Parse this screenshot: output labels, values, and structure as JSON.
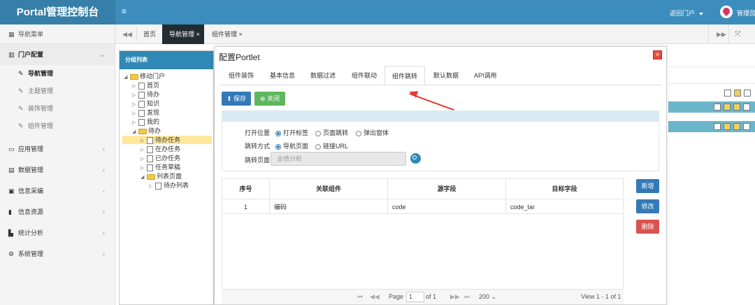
{
  "topbar": {
    "brand": "Portal管理控制台",
    "toggle_icon": "≡",
    "back_portal": "返回门户",
    "admin_label": "管理员"
  },
  "sidebar": {
    "header": "导航菜单",
    "menus": [
      {
        "label": "门户配置",
        "icon": "bank-icon",
        "open": true
      },
      {
        "label": "应用管理",
        "icon": "monitor-icon"
      },
      {
        "label": "数据管理",
        "icon": "database-icon"
      },
      {
        "label": "信息采编",
        "icon": "edit-icon"
      },
      {
        "label": "信息资源",
        "icon": "book-icon"
      },
      {
        "label": "统计分析",
        "icon": "chart-icon"
      },
      {
        "label": "系统管理",
        "icon": "gears-icon"
      }
    ],
    "submenu": [
      {
        "label": "导航管理",
        "active": true
      },
      {
        "label": "主题管理"
      },
      {
        "label": "装饰管理"
      },
      {
        "label": "组件管理"
      }
    ]
  },
  "tabbar": {
    "tabs": [
      {
        "label": "首页"
      },
      {
        "label": "导航管理",
        "active": true
      },
      {
        "label": "组件管理"
      }
    ]
  },
  "tree": {
    "header": "分组列表",
    "root": "移动门户",
    "nodes": [
      "首页",
      "待办",
      "知识",
      "发现",
      "我的",
      "待办",
      "待办任务",
      "在办任务",
      "已办任务",
      "任务草稿",
      "列表页面",
      "待办列表"
    ]
  },
  "dialog": {
    "title": "配置Portlet",
    "tabs": [
      "组件装饰",
      "基本信息",
      "数据过滤",
      "组件联动",
      "组件跳转",
      "默认数据",
      "API调用"
    ],
    "active_tab": "组件跳转",
    "save_label": "保存",
    "close_label": "关闭",
    "form": {
      "open_position_label": "打开位置",
      "open_options": [
        "打开标签",
        "页面跳转",
        "弹出窗体"
      ],
      "jump_mode_label": "跳转方式",
      "jump_options": [
        "导航页面",
        "链接URL"
      ],
      "jump_page_label": "跳转页面",
      "jump_page_placeholder": "业绩分析"
    },
    "grid": {
      "columns": [
        "序号",
        "关联组件",
        "源字段",
        "目标字段"
      ],
      "rows": [
        {
          "no": "1",
          "component": "编码",
          "source": "code",
          "target": "code_tar"
        }
      ],
      "pager": {
        "page_label": "Page",
        "page_value": "1",
        "of_label": "of 1",
        "page_size": "200",
        "view_text": "View 1 - 1 of 1"
      }
    },
    "side_buttons": {
      "add": "新增",
      "edit": "修改",
      "delete": "删除"
    }
  },
  "colors": {
    "topbar": "#3c8dbc",
    "brand_bg": "#367fa9",
    "primary_button": "#337ab7",
    "success_button": "#5cb85c",
    "danger_button": "#d9534f",
    "annotation_arrow": "#e53935"
  }
}
